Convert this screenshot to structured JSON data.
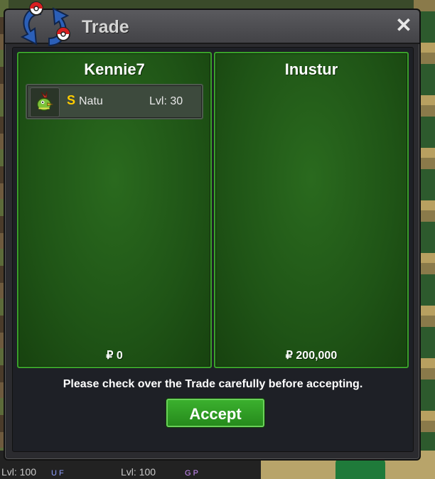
{
  "window": {
    "title": "Trade",
    "close_symbol": "✕"
  },
  "left_panel": {
    "player_name": "Kennie7",
    "items": [
      {
        "shiny_mark": "S",
        "name": "Natu",
        "level": "Lvl: 30",
        "icon": "natu-pokemon-icon"
      }
    ],
    "money": "₽ 0"
  },
  "right_panel": {
    "player_name": "Inustur",
    "money": "₽ 200,000"
  },
  "notice": "Please check over the Trade carefully before accepting.",
  "accept_label": "Accept",
  "background": {
    "level_left": "Lvl: 100",
    "level_mid": "Lvl: 100",
    "badge_left": "U F",
    "badge_mid": "G P"
  },
  "colors": {
    "panel_border": "#3aa22a",
    "accept": "#2f9c24",
    "shiny": "#ffcc00"
  }
}
